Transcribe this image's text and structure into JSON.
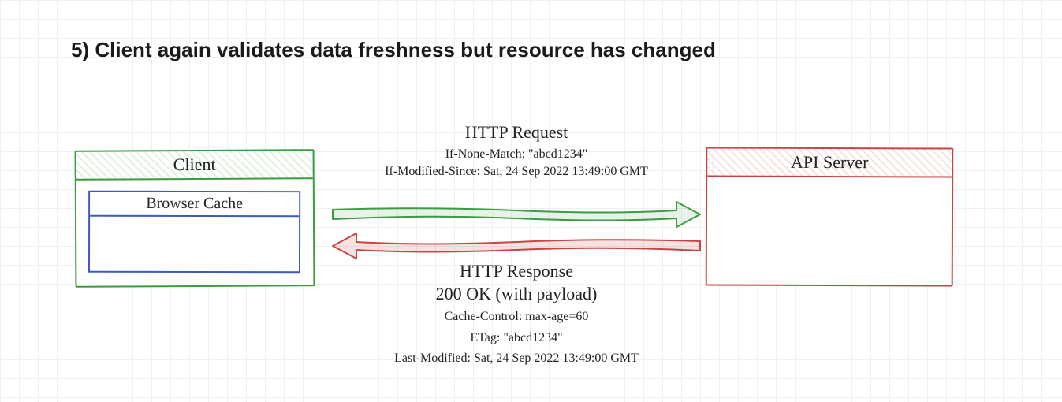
{
  "title": "5) Client again validates data freshness but resource has changed",
  "client": {
    "label": "Client",
    "cache_label": "Browser Cache"
  },
  "server": {
    "label": "API Server"
  },
  "request": {
    "heading": "HTTP Request",
    "h_if_none_match": "If-None-Match: \"abcd1234\"",
    "h_if_modified_since": "If-Modified-Since: Sat, 24 Sep 2022 13:49:00 GMT"
  },
  "response": {
    "heading": "HTTP Response",
    "status": "200 OK (with payload)",
    "h_cache_control": "Cache-Control: max-age=60",
    "h_etag": "ETag: \"abcd1234\"",
    "h_last_modified": "Last-Modified: Sat, 24 Sep 2022 13:49:00 GMT"
  },
  "colors": {
    "green": "#3b9c3f",
    "red": "#c84545",
    "blue": "#3c5bbb"
  }
}
